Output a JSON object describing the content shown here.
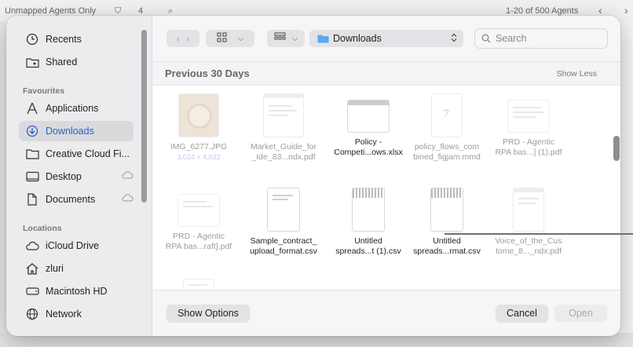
{
  "background": {
    "filter_label": "Unmapped Agents Only",
    "count_badge": "4",
    "pagination": "1-20 of 500 Agents"
  },
  "sidebar": {
    "items_top": [
      {
        "label": "Recents",
        "icon": "clock-icon"
      },
      {
        "label": "Shared",
        "icon": "shared-folder-icon"
      }
    ],
    "favourites_heading": "Favourites",
    "favourites": [
      {
        "label": "Applications",
        "icon": "applications-icon"
      },
      {
        "label": "Downloads",
        "icon": "download-icon",
        "active": true
      },
      {
        "label": "Creative Cloud Fi...",
        "icon": "folder-icon"
      },
      {
        "label": "Desktop",
        "icon": "desktop-icon",
        "cloud": true
      },
      {
        "label": "Documents",
        "icon": "document-icon",
        "cloud": true
      }
    ],
    "locations_heading": "Locations",
    "locations": [
      {
        "label": "iCloud Drive",
        "icon": "cloud-icon"
      },
      {
        "label": "zluri",
        "icon": "home-icon"
      },
      {
        "label": "Macintosh HD",
        "icon": "disk-icon"
      },
      {
        "label": "Network",
        "icon": "globe-icon"
      }
    ]
  },
  "toolbar": {
    "location": "Downloads",
    "search_placeholder": "Search"
  },
  "content": {
    "section_title": "Previous 30 Days",
    "section_toggle": "Show Less",
    "files_row1": [
      {
        "line1": "IMG_6277.JPG",
        "line2": "",
        "sub": "3,024 × 4,032",
        "dim": true,
        "kind": "img"
      },
      {
        "line1": "Market_Guide_for",
        "line2": "_Ide_83...ndx.pdf",
        "dim": true,
        "kind": "doc"
      },
      {
        "line1": "Policy -",
        "line2": "Competi...ows.xlsx",
        "dim": false,
        "kind": "xlsx"
      },
      {
        "line1": "policy_flows_com",
        "line2": "bined_figjam.mmd",
        "dim": true,
        "kind": "unknown"
      },
      {
        "line1": "PRD - Agentic",
        "line2": "RPA bas...] (1).pdf",
        "dim": true,
        "kind": "doc"
      }
    ],
    "files_row2": [
      {
        "line1": "PRD - Agentic",
        "line2": "RPA bas...raft].pdf",
        "dim": true,
        "kind": "doc"
      },
      {
        "line1": "Sample_contract_",
        "line2": "upload_format.csv",
        "dim": false,
        "kind": "doc"
      },
      {
        "line1": "Untitled",
        "line2": "spreads...t (1).csv",
        "dim": false,
        "kind": "stripes"
      },
      {
        "line1": "Untitled",
        "line2": "spreads...rmat.csv",
        "dim": false,
        "kind": "stripes"
      },
      {
        "line1": "Voice_of_the_Cus",
        "line2": "tome_8..._ndx.pdf",
        "dim": true,
        "kind": "doc"
      }
    ]
  },
  "footer": {
    "show_options": "Show Options",
    "cancel": "Cancel",
    "open": "Open"
  }
}
